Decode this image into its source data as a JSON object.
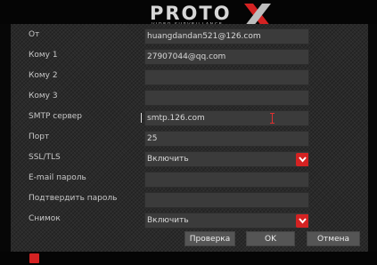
{
  "header": {
    "logo_text": "PROTO",
    "logo_sub": "VIDEO SURVEILLANCE"
  },
  "form": {
    "from": {
      "label": "От",
      "value": "huangdandan521@126.com"
    },
    "to1": {
      "label": "Кому 1",
      "value": "27907044@qq.com"
    },
    "to2": {
      "label": "Кому 2",
      "value": ""
    },
    "to3": {
      "label": "Кому 3",
      "value": ""
    },
    "smtp": {
      "label": "SMTP сервер",
      "value": "smtp.126.com"
    },
    "port": {
      "label": "Порт",
      "value": "25"
    },
    "ssl": {
      "label": "SSL/TLS",
      "value": "Включить"
    },
    "email_password": {
      "label": "E-mail пароль",
      "value": ""
    },
    "confirm_password": {
      "label": "Подтвердить пароль",
      "value": ""
    },
    "snapshot": {
      "label": "Снимок",
      "value": "Включить"
    }
  },
  "buttons": {
    "test": "Проверка",
    "ok": "OK",
    "cancel": "Отмена"
  },
  "colors": {
    "accent": "#d42222",
    "panel": "#2a2a2a",
    "field": "#3b3b3b"
  },
  "icons": {
    "dropdown": "chevron-down-icon",
    "status": "status-icon",
    "cursor": "text-cursor-icon"
  }
}
